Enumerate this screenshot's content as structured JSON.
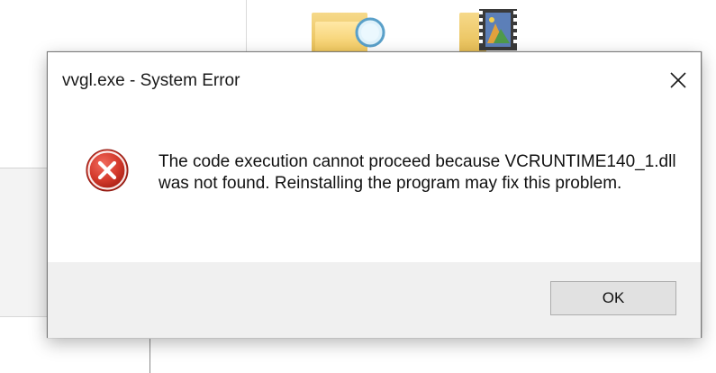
{
  "dialog": {
    "title": "vvgl.exe - System Error",
    "close_icon": "close-icon",
    "icon": "error-icon",
    "message": "The code execution cannot proceed because VCRUNTIME140_1.dll was not found. Reinstalling the program may fix this problem.",
    "ok_label": "OK"
  },
  "background": {
    "icons": [
      "search-folder-icon",
      "video-folder-icon"
    ]
  },
  "colors": {
    "error_red": "#c42b1c",
    "footer_bg": "#f0f0f0",
    "button_bg": "#e1e1e1"
  }
}
